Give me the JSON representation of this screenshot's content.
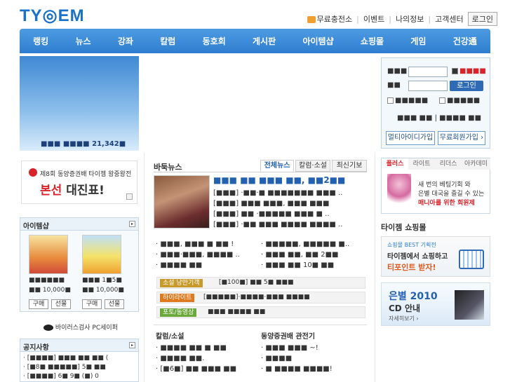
{
  "header": {
    "logo": "TY◎EM",
    "links": [
      "무료충전소",
      "이벤트",
      "나의정보",
      "고객센터"
    ],
    "login_button": "로그인"
  },
  "nav": [
    "랭킹",
    "뉴스",
    "강좌",
    "칼럼",
    "동호회",
    "게시판",
    "아이템샵",
    "쇼핑몰",
    "게임",
    "건강通"
  ],
  "banner": {
    "caption": "■■■ ■■■■",
    "count": "21,342■"
  },
  "login": {
    "id_label": "■■■",
    "pw_label": "■■",
    "save_label": "■■■■",
    "login_btn": "로그인",
    "opt1": "■■■■■",
    "opt2": "■■■■■",
    "find_links": "■■■ ■■  |  ■■■■ ■■",
    "multi_id": "멀티아이디가입",
    "free_join": "무료회원가입 ›"
  },
  "promo": {
    "line1": "제8회 동양증권배 타이젬 왕중왕전",
    "line2": "본선",
    "line3": "대진표!"
  },
  "itemshop": {
    "title": "아이템샵",
    "items": [
      {
        "name": "■■■■■■",
        "price": "■■ 10,000■",
        "buy": "구매",
        "gift": "선물"
      },
      {
        "name": "■■■ 1■5■",
        "price": "■■ 10,000■",
        "buy": "구매",
        "gift": "선물"
      }
    ]
  },
  "virus": "바이러스검사 PC세이퍼",
  "notice": {
    "title": "공지사항",
    "items": [
      "· [■■■■] ■■■ ■■ ■■ (",
      "· [■8■ ■■■■■] 5■ ■■",
      "· [■■■■] 6■ 9■ (■) 0"
    ]
  },
  "news": {
    "title": "바둑뉴스",
    "tabs": [
      "전체뉴스",
      "칼럼·소설",
      "최신기보"
    ],
    "headline": "■■■ ■■ ■■■ ■■, ■■2■■",
    "lines": [
      "[■■■] ·■■·■ ■■■■■■■ ■■■ ..",
      "[■■■] ■■■ ■■■, ■■■ ■■■",
      "[■■■] ■■ ·■■■■■ ■■■ ■ ..",
      "[■■■] ·■■ ■■■ ■■■■ ■■■■ .."
    ],
    "list_left": [
      "· ■■■, ■■■ ■ ■■ !",
      "· ■■■·■■■, ■■■■ ..",
      "· ■■■■ ■■"
    ],
    "list_right": [
      "· ■■■■■, ■■■■■ ■..",
      "· ■■■ ■■, ■■ 2■■",
      "· ■■■ ■■ 10■ ■■"
    ],
    "bars": [
      {
        "badge": "소설 낭만기객",
        "text": "[■100■] ■■ 5■ ■■■",
        "color": "#c89a2c"
      },
      {
        "badge": "하이라이트",
        "text": "[■■■■■]·■■■■·■■■ ■■■■",
        "color": "#e07a20"
      },
      {
        "badge": "포토/동영상",
        "text": "■■■ ■■■■ ■■",
        "color": "#6aa83a"
      }
    ],
    "col_left_title": "칼럼/소설",
    "col_right_title": "동양증권배 관전기",
    "col_left": [
      "· ■■■■ ■■ ■ ■■",
      "· ■■■■ ■■.",
      "· [■6■] ■■ ■■■ ■■"
    ],
    "col_right": [
      "· ■■■ ■■■ ~!",
      "· ■■■■",
      "· ■ ■■■■ ■■■■!"
    ]
  },
  "plus": {
    "tabs": [
      "플러스",
      "라이트",
      "리더스",
      "아카데미"
    ],
    "text1": "새 번의 베팅기회 와",
    "text2": "은별 대국을 즐길 수 있는",
    "text3": "매니아를 위한 회원제"
  },
  "shop": {
    "title": "타이젬 쇼핑몰",
    "small": "쇼핑몰 BEST 기획전",
    "line1": "타이젬에서 쇼핑하고",
    "line2": "티포인트 받자!"
  },
  "cd": {
    "title": "은별 2010",
    "sub": "CD 안내",
    "more": "자세히보기 ›"
  },
  "colors": {
    "nav": "#3a88d8",
    "brand": "#1a72c8",
    "red": "#d8232a"
  }
}
